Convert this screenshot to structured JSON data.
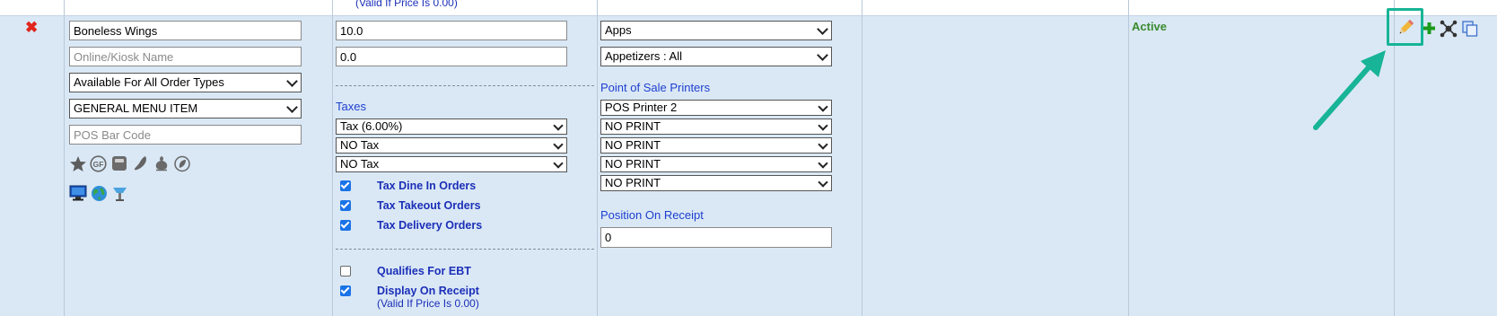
{
  "top_note": "(Valid If Price Is 0.00)",
  "delete_glyph": "✖",
  "name": {
    "value": "Boneless Wings",
    "online_placeholder": "Online/Kiosk Name",
    "order_types": "Available For All Order Types",
    "item_type": "GENERAL MENU ITEM",
    "barcode_placeholder": "POS Bar Code"
  },
  "attribute_icons": [
    "star-icon",
    "gluten-free-icon",
    "scale-icon",
    "chili-icon",
    "ginger-icon",
    "leaf-icon"
  ],
  "channel_icons": [
    "monitor-icon",
    "globe-icon",
    "kiosk-icon"
  ],
  "pricing": {
    "price": "10.0",
    "second_price": "0.0"
  },
  "taxes": {
    "heading": "Taxes",
    "selects": [
      "Tax (6.00%)",
      "NO Tax",
      "NO Tax"
    ],
    "options": [
      {
        "label": "Tax Dine In Orders",
        "checked": true
      },
      {
        "label": "Tax Takeout Orders",
        "checked": true
      },
      {
        "label": "Tax Delivery Orders",
        "checked": true
      }
    ]
  },
  "flags": {
    "ebt": {
      "label": "Qualifies For EBT",
      "checked": false
    },
    "receipt": {
      "label": "Display On Receipt",
      "checked": true,
      "note": "(Valid If Price Is 0.00)"
    }
  },
  "category": {
    "group": "Apps",
    "subcategory": "Appetizers : All"
  },
  "printers": {
    "heading": "Point of Sale Printers",
    "values": [
      "POS Printer 2",
      "NO PRINT",
      "NO PRINT",
      "NO PRINT",
      "NO PRINT"
    ]
  },
  "receipt_position": {
    "heading": "Position On Receipt",
    "value": "0"
  },
  "status": {
    "text": "Active",
    "color": "#3a8a2e"
  },
  "actions": [
    "edit-icon",
    "add-icon",
    "modifiers-icon",
    "copy-icon"
  ],
  "colors": {
    "row_bg": "#dae8f5",
    "label_blue": "#1b2fb8",
    "highlight": "#17b497",
    "delete_red": "#e0251b"
  }
}
